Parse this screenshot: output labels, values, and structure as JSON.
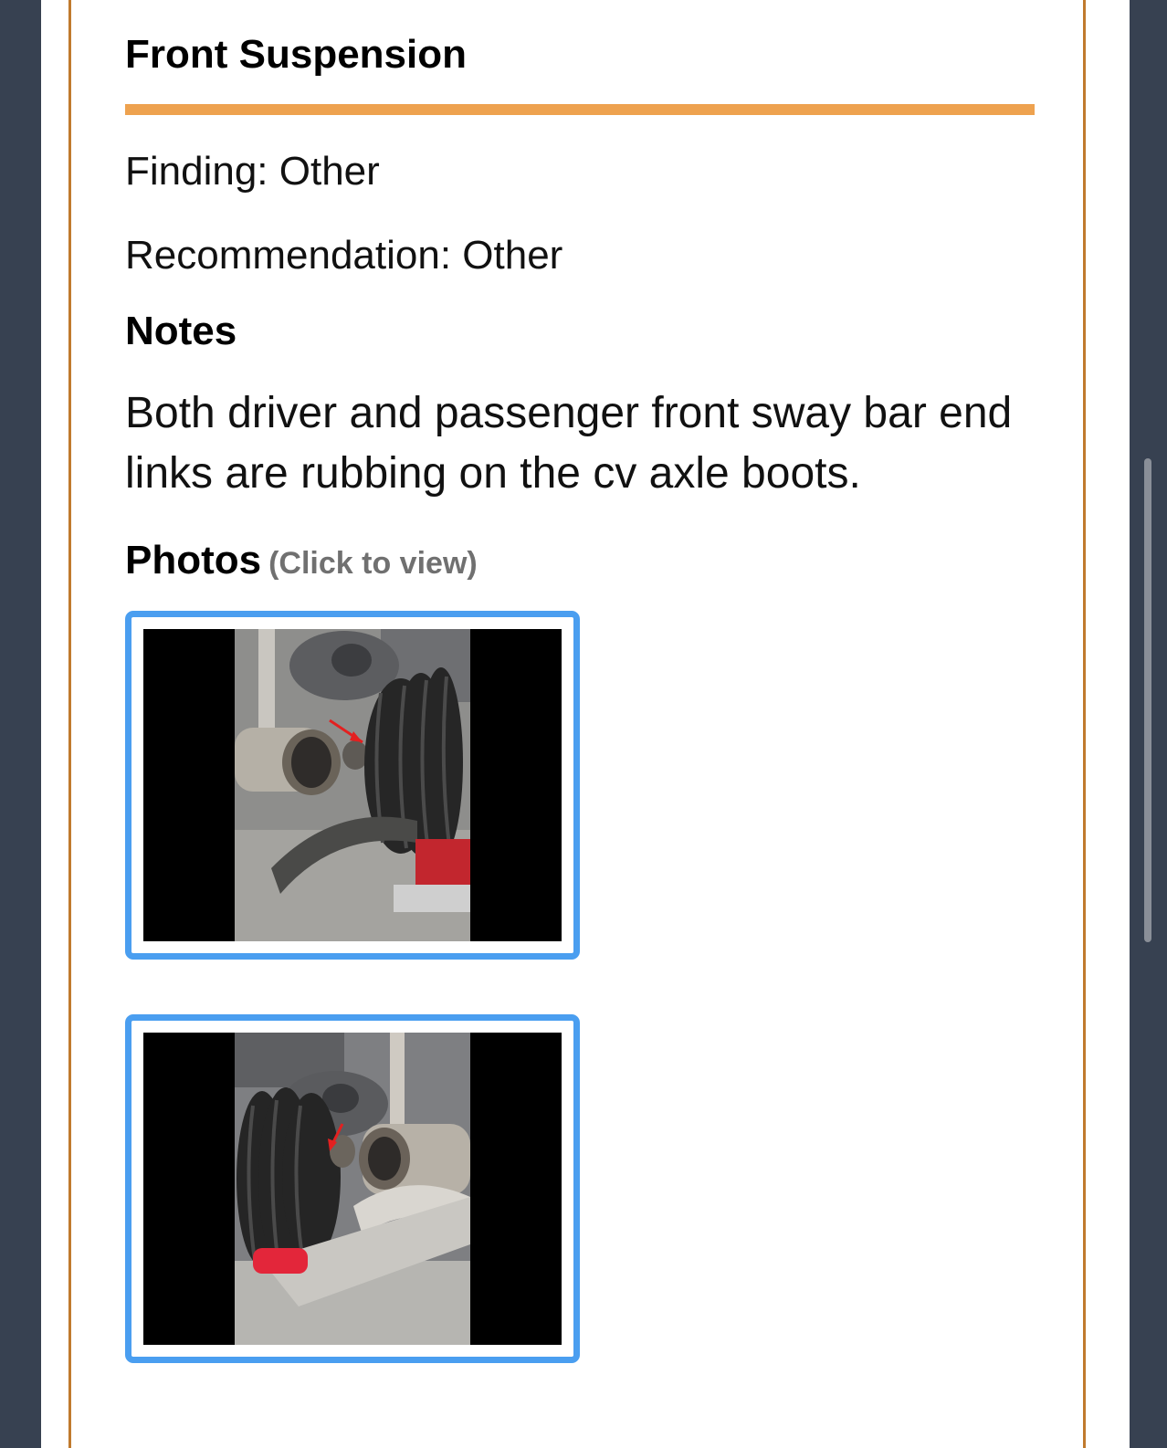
{
  "section": {
    "title": "Front Suspension"
  },
  "finding": {
    "text": "Finding: Other"
  },
  "recommendation": {
    "text": "Recommendation: Other"
  },
  "notes": {
    "heading": "Notes",
    "body": "Both driver and passenger front sway bar end links are rubbing on the cv axle boots."
  },
  "photos": {
    "heading": "Photos",
    "hint": "(Click to view)",
    "items": [
      {
        "subject": "sway bar end link near cv axle boot (left)"
      },
      {
        "subject": "sway bar end link near cv axle boot (right)"
      }
    ]
  },
  "colors": {
    "accent_rule": "#eea24f",
    "card_border": "#c07a2e",
    "photo_border": "#4a9ef0",
    "background": "#374151"
  }
}
